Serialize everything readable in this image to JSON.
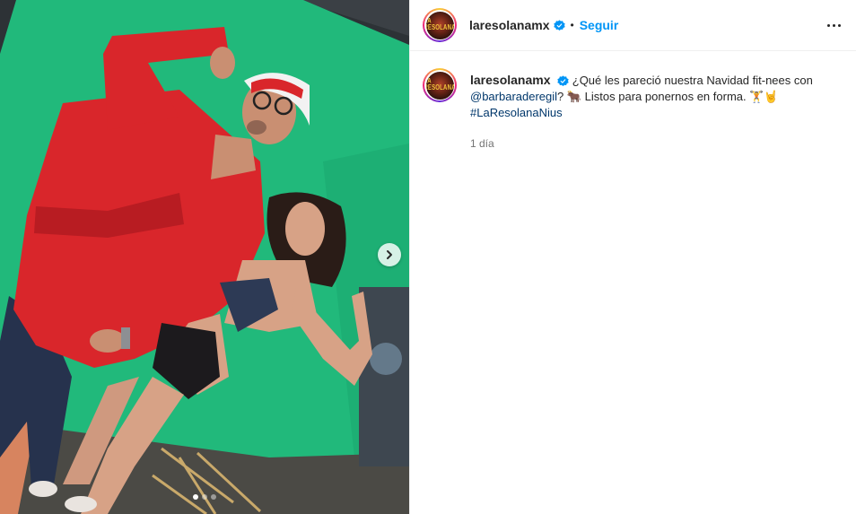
{
  "post": {
    "username": "laresolanamx",
    "follow_label": "Seguir",
    "separator": "•",
    "avatar_text": "LA RESOLANA",
    "caption": {
      "text_1": "¿Qué les pareció nuestra Navidad fit-nees con",
      "mention": "@barbaraderegil",
      "text_2": "? 🐂 Listos para ponernos en forma. 🏋🤘",
      "hashtag": "#LaResolanaNius"
    },
    "timestamp": "1 día"
  },
  "carousel": {
    "slides": 3,
    "active_index": 0
  },
  "icons": {
    "verified": "verified-badge-icon",
    "more": "more-options-icon",
    "next": "chevron-right-icon"
  },
  "colors": {
    "follow": "#0095f6",
    "link": "#00376b",
    "green_screen": "#1fb97a",
    "robe": "#d9262b"
  }
}
